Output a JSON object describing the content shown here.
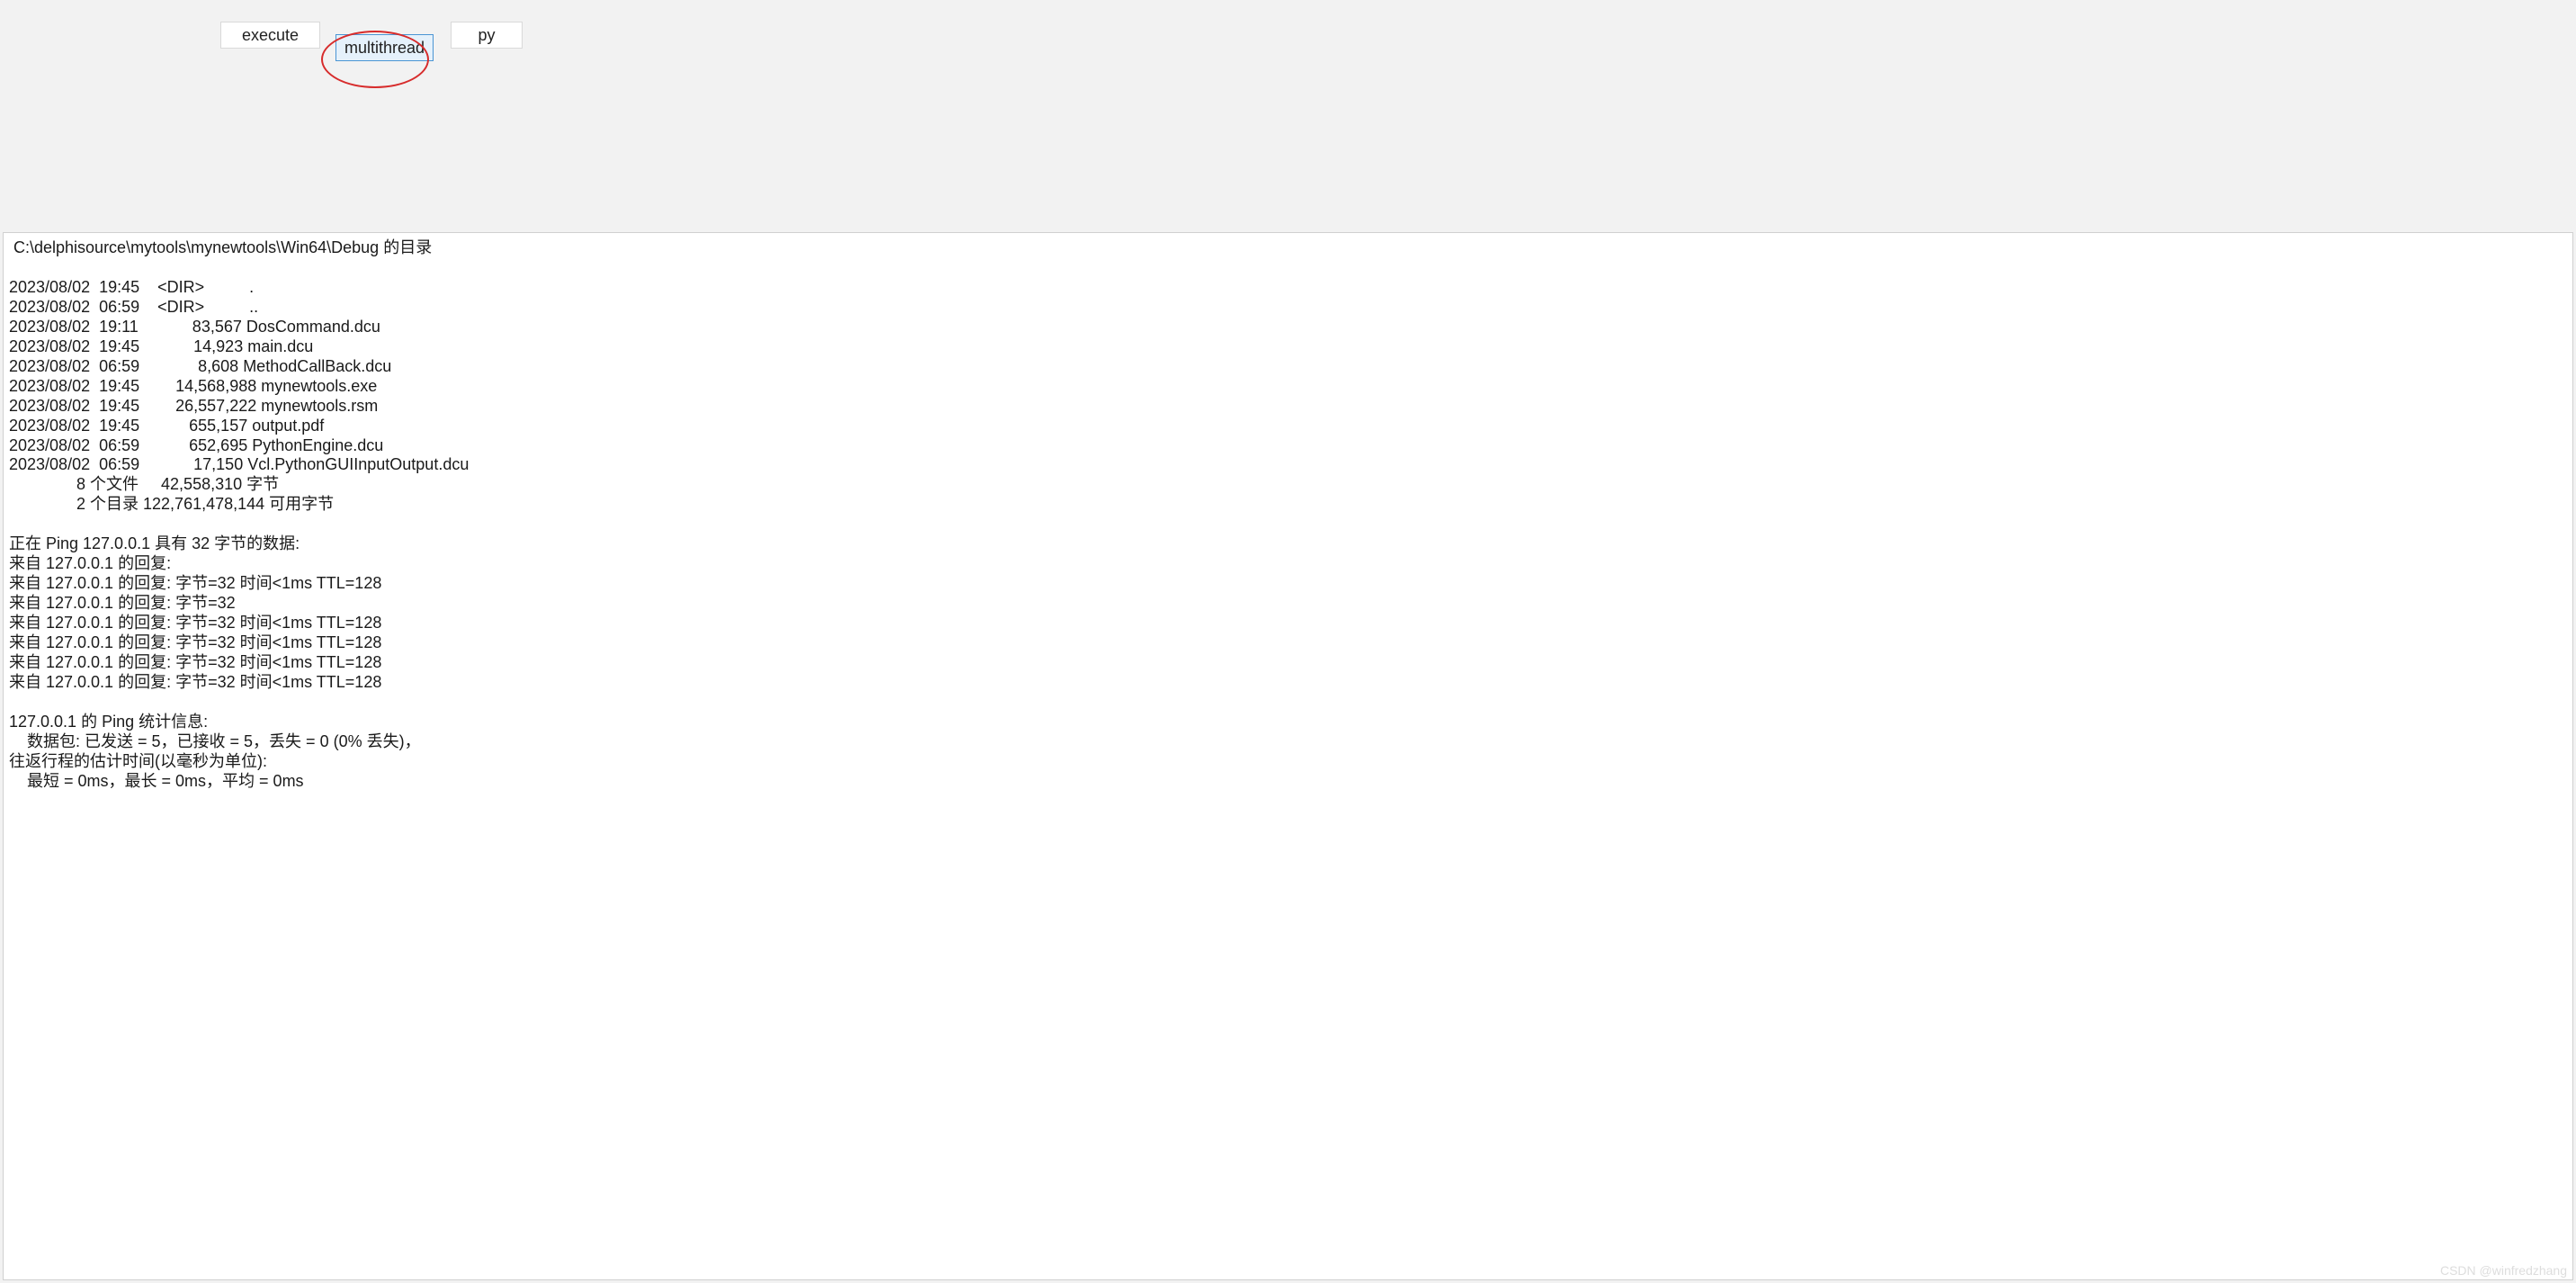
{
  "buttons": {
    "execute": "execute",
    "multithread": "multithread",
    "py": "py"
  },
  "output": {
    "dir_header": " C:\\delphisource\\mytools\\mynewtools\\Win64\\Debug 的目录",
    "entries": [
      "2023/08/02  19:45    <DIR>          .",
      "2023/08/02  06:59    <DIR>          ..",
      "2023/08/02  19:11            83,567 DosCommand.dcu",
      "2023/08/02  19:45            14,923 main.dcu",
      "2023/08/02  06:59             8,608 MethodCallBack.dcu",
      "2023/08/02  19:45        14,568,988 mynewtools.exe",
      "2023/08/02  19:45        26,557,222 mynewtools.rsm",
      "2023/08/02  19:45           655,157 output.pdf",
      "2023/08/02  06:59           652,695 PythonEngine.dcu",
      "2023/08/02  06:59            17,150 Vcl.PythonGUIInputOutput.dcu",
      "               8 个文件     42,558,310 字节",
      "               2 个目录 122,761,478,144 可用字节"
    ],
    "ping_header": "正在 Ping 127.0.0.1 具有 32 字节的数据:",
    "ping_replies": [
      "来自 127.0.0.1 的回复:",
      "来自 127.0.0.1 的回复: 字节=32 时间<1ms TTL=128",
      "来自 127.0.0.1 的回复: 字节=32",
      "来自 127.0.0.1 的回复: 字节=32 时间<1ms TTL=128",
      "来自 127.0.0.1 的回复: 字节=32 时间<1ms TTL=128",
      "来自 127.0.0.1 的回复: 字节=32 时间<1ms TTL=128",
      "来自 127.0.0.1 的回复: 字节=32 时间<1ms TTL=128"
    ],
    "ping_stats_header": "127.0.0.1 的 Ping 统计信息:",
    "ping_stats_packets": "    数据包: 已发送 = 5，已接收 = 5，丢失 = 0 (0% 丢失)，",
    "ping_rtt_header": "往返行程的估计时间(以毫秒为单位):",
    "ping_rtt_values": "    最短 = 0ms，最长 = 0ms，平均 = 0ms"
  },
  "watermark": "CSDN @winfredzhang"
}
